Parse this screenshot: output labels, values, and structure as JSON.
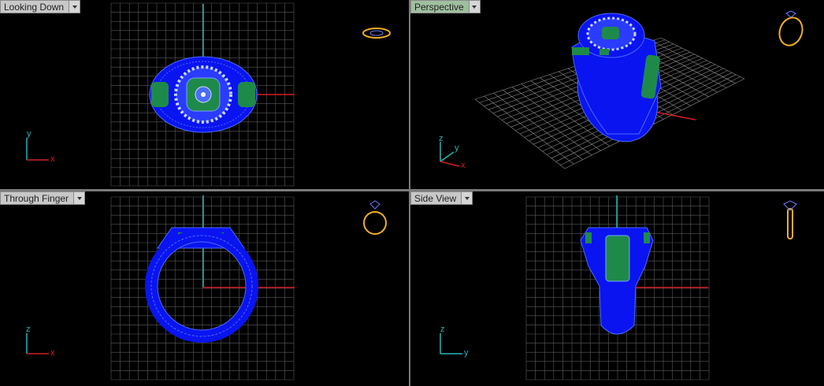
{
  "viewports": [
    {
      "id": "top",
      "label": "Looking Down",
      "axis_h": "x",
      "axis_v": "y",
      "active": false
    },
    {
      "id": "perspective",
      "label": "Perspective",
      "axis_h": "x",
      "axis_v": "z",
      "axis_extra": "y",
      "active": true
    },
    {
      "id": "front",
      "label": "Through Finger",
      "axis_h": "x",
      "axis_v": "z",
      "active": false
    },
    {
      "id": "side",
      "label": "Side View",
      "axis_h": "y",
      "axis_v": "z",
      "active": false
    }
  ],
  "colors": {
    "background": "#000000",
    "grid": "#5a5a5a",
    "model_fill": "#0a14f0",
    "model_wire": "#4a6bff",
    "stone": "#1e8a4a",
    "x_axis": "#d22020",
    "y_axis": "#28b4b4",
    "preview_icon": "#f0b020",
    "divider": "#7a7a7a"
  },
  "icons": [
    "ring-preview-icon",
    "axis-gizmo-icon",
    "dropdown-arrow-icon"
  ]
}
